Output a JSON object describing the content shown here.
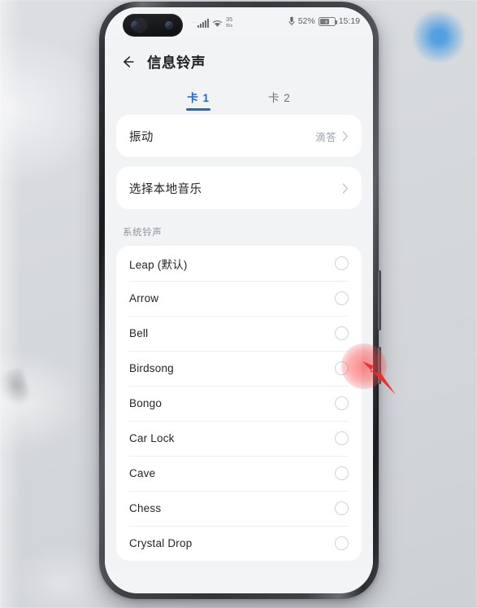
{
  "statusbar": {
    "signal_icon": "cellular-signal-icon",
    "wifi_icon": "wifi-icon",
    "dual_sim_mark": "··",
    "network_rate_value": "35",
    "network_rate_unit": "B/s",
    "mic_icon": "microphone-icon",
    "battery_percent": "52%",
    "battery_state": "charging",
    "time": "15:19"
  },
  "appbar": {
    "back_icon": "back-arrow-icon",
    "title": "信息铃声"
  },
  "tabs": [
    {
      "label": "卡 1",
      "active": true
    },
    {
      "label": "卡 2",
      "active": false
    }
  ],
  "settings": {
    "vibration": {
      "label": "振动",
      "value": "滴答",
      "chevron_icon": "chevron-right-icon"
    },
    "local_music": {
      "label": "选择本地音乐",
      "value": "",
      "chevron_icon": "chevron-right-icon"
    }
  },
  "ringtone_section": {
    "title": "系统铃声",
    "items": [
      {
        "name": "Leap (默认)",
        "selected": false
      },
      {
        "name": "Arrow",
        "selected": false
      },
      {
        "name": "Bell",
        "selected": false
      },
      {
        "name": "Birdsong",
        "selected": false
      },
      {
        "name": "Bongo",
        "selected": false
      },
      {
        "name": "Car Lock",
        "selected": false
      },
      {
        "name": "Cave",
        "selected": false
      },
      {
        "name": "Chess",
        "selected": false
      },
      {
        "name": "Crystal Drop",
        "selected": false
      }
    ]
  },
  "overlay": {
    "tap_indicator": "tap-highlight-circle",
    "cursor": "mouse-cursor-arrow",
    "accent_color": "#2266cf",
    "tap_color": "#f83c3c"
  }
}
